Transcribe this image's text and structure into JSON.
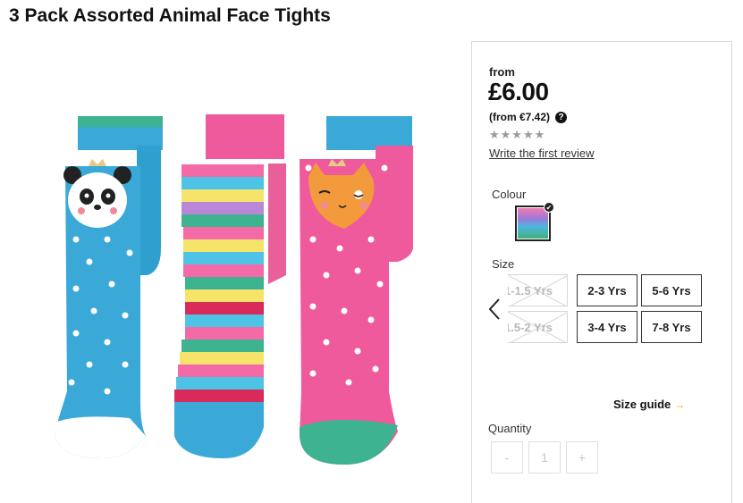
{
  "product": {
    "title": "3 Pack Assorted Animal Face Tights"
  },
  "price_panel": {
    "from_label": "from",
    "price": "£6.00",
    "euro_price": "(from €7.42)",
    "help_icon": "?",
    "stars": "★★★★★",
    "review_link": "Write the first review"
  },
  "colour": {
    "label": "Colour",
    "selected_check": "✔"
  },
  "size": {
    "label": "Size",
    "options": [
      {
        "label": "1-1.5 Yrs",
        "available": false
      },
      {
        "label": "2-3 Yrs",
        "available": true
      },
      {
        "label": "5-6 Yrs",
        "available": true
      },
      {
        "label": "1.5-2 Yrs",
        "available": false
      },
      {
        "label": "3-4 Yrs",
        "available": true
      },
      {
        "label": "7-8 Yrs",
        "available": true
      }
    ],
    "guide_label": "Size guide",
    "guide_arrow": "→"
  },
  "quantity": {
    "label": "Quantity",
    "minus": "-",
    "value": "1",
    "plus": "+"
  },
  "colors": {
    "brand_text": "#111111",
    "accent_arrow": "#f0a000",
    "star_gray": "#9a9a9a"
  }
}
